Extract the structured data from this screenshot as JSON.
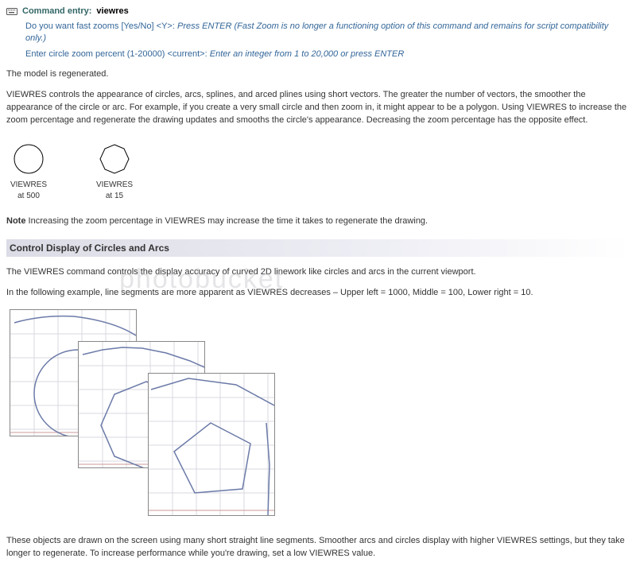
{
  "command_entry": {
    "label": "Command entry:",
    "value": "viewres"
  },
  "prompts": [
    {
      "q": "Do you want fast zooms [Yes/No] <Y>:",
      "action": "Press ENTER",
      "note": "(Fast Zoom is no longer a functioning option of this command and remains for script compatibility only.)"
    },
    {
      "q": "Enter circle zoom percent (1-20000) <current>:",
      "action": "Enter an integer from 1 to 20,000 or press ENTER",
      "note": ""
    }
  ],
  "body": {
    "regen": "The model is regenerated.",
    "desc": "VIEWRES controls the appearance of circles, arcs, splines, and arced plines using short vectors. The greater the number of vectors, the smoother the appearance of the circle or arc. For example, if you create a very small circle and then zoom in, it might appear to be a polygon. Using VIEWRES to increase the zoom percentage and regenerate the drawing updates and smooths the circle's appearance. Decreasing the zoom percentage has the opposite effect.",
    "viewres_items": [
      {
        "label1": "VIEWRES",
        "label2": "at 500"
      },
      {
        "label1": "VIEWRES",
        "label2": "at 15"
      }
    ],
    "note_label": "Note",
    "note_text": "Increasing the zoom percentage in VIEWRES may increase the time it takes to regenerate the drawing."
  },
  "section": {
    "heading": "Control Display of Circles and Arcs",
    "p1": "The VIEWRES command controls the display accuracy of curved 2D linework like circles and arcs in the current viewport.",
    "p2": "In the following example, line segments are more apparent as VIEWRES decreases – Upper left = 1000, Middle = 100, Lower right = 10.",
    "p3": "These objects are drawn on the screen using many short straight line segments. Smoother arcs and circles display with higher VIEWRES settings, but they take longer to regenerate. To increase performance while you're drawing, set a low VIEWRES value."
  },
  "watermark": "photobucket",
  "chart_data": [
    {
      "type": "polygon",
      "label": "VIEWRES at 500",
      "sides": 64
    },
    {
      "type": "polygon",
      "label": "VIEWRES at 15",
      "sides": 9
    },
    {
      "type": "viewport-example",
      "viewres": 1000,
      "position": "upper-left"
    },
    {
      "type": "viewport-example",
      "viewres": 100,
      "position": "middle"
    },
    {
      "type": "viewport-example",
      "viewres": 10,
      "position": "lower-right"
    }
  ]
}
